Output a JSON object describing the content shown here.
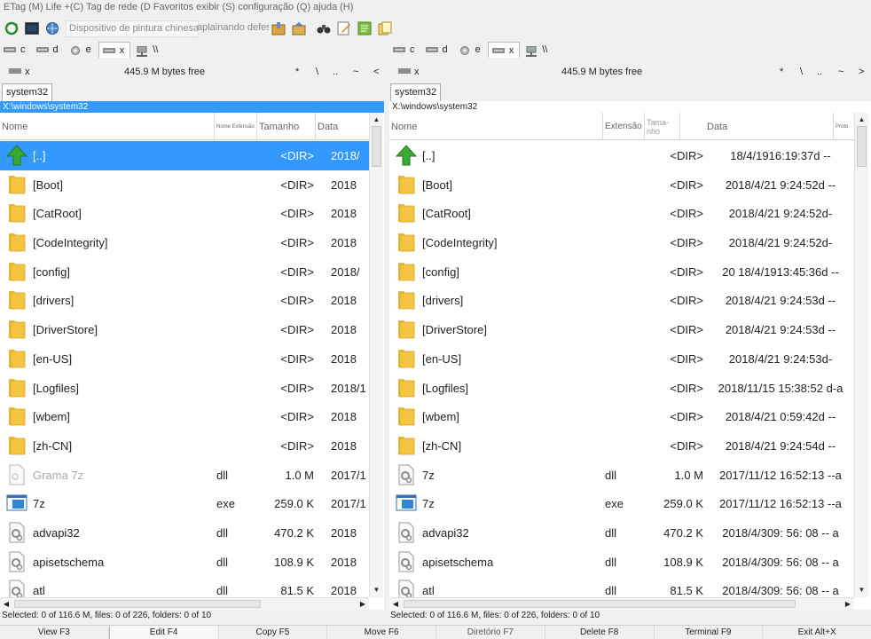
{
  "menu": {
    "text": "ETag (M) Life +(C) Tag de rede (D Favoritos exibir (S) configuração (Q) ajuda (H)"
  },
  "toolbar": {
    "combo1": "Dispositivo de pintura chinesa",
    "combo2": "aplainando defesa"
  },
  "drives_left": [
    {
      "label": "c"
    },
    {
      "label": "d"
    },
    {
      "label": "e"
    },
    {
      "label": "x",
      "selected": true
    },
    {
      "label": "\\\\"
    }
  ],
  "drives_right": [
    {
      "label": "c"
    },
    {
      "label": "d"
    },
    {
      "label": "e"
    },
    {
      "label": "x",
      "selected": true
    },
    {
      "label": "\\\\"
    }
  ],
  "left": {
    "drive": "x",
    "free": "445.9 M bytes free",
    "nav": [
      "*",
      "\\",
      "..",
      "~",
      "<"
    ],
    "tab": "system32",
    "path": "X:\\windows\\system32",
    "columns": {
      "name": "Nome",
      "ext": "Nome Extensão",
      "size": "Tamanho",
      "date": "Data"
    },
    "rows": [
      {
        "icon": "up",
        "name": "[..]",
        "ext": "",
        "size": "<DIR>",
        "date": "2018/",
        "selected": true
      },
      {
        "icon": "folder",
        "name": "[Boot]",
        "ext": "",
        "size": "<DIR>",
        "date": "2018"
      },
      {
        "icon": "folder",
        "name": "[CatRoot]",
        "ext": "",
        "size": "<DIR>",
        "date": "2018"
      },
      {
        "icon": "folder",
        "name": "[CodeIntegrity]",
        "ext": "",
        "size": "<DIR>",
        "date": "2018"
      },
      {
        "icon": "folder",
        "name": "[config]",
        "ext": "",
        "size": "<DIR>",
        "date": "2018/"
      },
      {
        "icon": "folder",
        "name": "[drivers]",
        "ext": "",
        "size": "<DIR>",
        "date": "2018"
      },
      {
        "icon": "folder",
        "name": "[DriverStore]",
        "ext": "",
        "size": "<DIR>",
        "date": "2018"
      },
      {
        "icon": "folder",
        "name": "[en-US]",
        "ext": "",
        "size": "<DIR>",
        "date": "2018"
      },
      {
        "icon": "folder",
        "name": "[Logfiles]",
        "ext": "",
        "size": "<DIR>",
        "date": "2018/1"
      },
      {
        "icon": "folder",
        "name": "[wbem]",
        "ext": "",
        "size": "<DIR>",
        "date": "2018"
      },
      {
        "icon": "folder",
        "name": "[zh-CN]",
        "ext": "",
        "size": "<DIR>",
        "date": "2018"
      },
      {
        "icon": "file",
        "name": "Grama 7z",
        "ext": "dll",
        "size": "1.0 M",
        "date": "2017/1",
        "grey": true
      },
      {
        "icon": "exe",
        "name": "7z",
        "ext": "exe",
        "size": "259.0 K",
        "date": "2017/1"
      },
      {
        "icon": "gear",
        "name": "advapi32",
        "ext": "dll",
        "size": "470.2 K",
        "date": "2018"
      },
      {
        "icon": "gear",
        "name": "apisetschema",
        "ext": "dll",
        "size": "108.9 K",
        "date": "2018"
      },
      {
        "icon": "gear",
        "name": "atl",
        "ext": "dll",
        "size": "81.5 K",
        "date": "2018"
      }
    ],
    "status": "Selected: 0 of 116.6 M, files: 0 of 226, folders: 0 of 10"
  },
  "right": {
    "drive": "x",
    "free": "445.9 M bytes free",
    "nav": [
      "*",
      "\\",
      "..",
      "~",
      ">"
    ],
    "tab": "system32",
    "path": "X:\\windows\\system32",
    "columns": {
      "name": "Nome",
      "ext": "Extensão",
      "size": "Tama-nho",
      "date": "Data",
      "attr": "Proto"
    },
    "rows": [
      {
        "icon": "up",
        "name": "[..]",
        "ext": "",
        "size": "<DIR>",
        "date": "18/4/1916:19:37d --"
      },
      {
        "icon": "folder",
        "name": "[Boot]",
        "ext": "",
        "size": "<DIR>",
        "date": "2018/4/21 9:24:52d --"
      },
      {
        "icon": "folder",
        "name": "[CatRoot]",
        "ext": "",
        "size": "<DIR>",
        "date": "2018/4/21 9:24:52d-"
      },
      {
        "icon": "folder",
        "name": "[CodeIntegrity]",
        "ext": "",
        "size": "<DIR>",
        "date": "2018/4/21 9:24:52d-"
      },
      {
        "icon": "folder",
        "name": "[config]",
        "ext": "",
        "size": "<DIR>",
        "date": "20 18/4/1913:45:36d --"
      },
      {
        "icon": "folder",
        "name": "[drivers]",
        "ext": "",
        "size": "<DIR>",
        "date": "2018/4/21 9:24:53d --"
      },
      {
        "icon": "folder",
        "name": "[DriverStore]",
        "ext": "",
        "size": "<DIR>",
        "date": "2018/4/21 9:24:53d --"
      },
      {
        "icon": "folder",
        "name": "[en-US]",
        "ext": "",
        "size": "<DIR>",
        "date": "2018/4/21 9:24:53d-"
      },
      {
        "icon": "folder",
        "name": "[Logfiles]",
        "ext": "",
        "size": "<DIR>",
        "date": "2018/11/15 15:38:52 d-a"
      },
      {
        "icon": "folder",
        "name": "[wbem]",
        "ext": "",
        "size": "<DIR>",
        "date": "2018/4/21 0:59:42d --"
      },
      {
        "icon": "folder",
        "name": "[zh-CN]",
        "ext": "",
        "size": "<DIR>",
        "date": "2018/4/21 9:24:54d --"
      },
      {
        "icon": "gear",
        "name": "7z",
        "ext": "dll",
        "size": "1.0 M",
        "date": "2017/11/12 16:52:13 --a"
      },
      {
        "icon": "exe",
        "name": "7z",
        "ext": "exe",
        "size": "259.0 K",
        "date": "2017/11/12 16:52:13 --a"
      },
      {
        "icon": "gear",
        "name": "advapi32",
        "ext": "dll",
        "size": "470.2 K",
        "date": "2018/4/309: 56: 08 -- a"
      },
      {
        "icon": "gear",
        "name": "apisetschema",
        "ext": "dll",
        "size": "108.9 K",
        "date": "2018/4/309: 56: 08 -- a"
      },
      {
        "icon": "gear",
        "name": "atl",
        "ext": "dll",
        "size": "81.5 K",
        "date": "2018/4/309: 56: 08 -- a"
      }
    ],
    "status": "Selected: 0 of 116.6 M, files: 0 of 226, folders: 0 of 10"
  },
  "fkeys": [
    "View F3",
    "Edit F4",
    "Copy F5",
    "Move F6",
    "Diretório F7",
    "Delete F8",
    "Terminal F9",
    "Exit Alt+X"
  ],
  "colors": {
    "selection": "#3399ff",
    "folder": "#f5c542",
    "up_arrow": "#3aaa35",
    "address_bar": "#3399ff"
  }
}
